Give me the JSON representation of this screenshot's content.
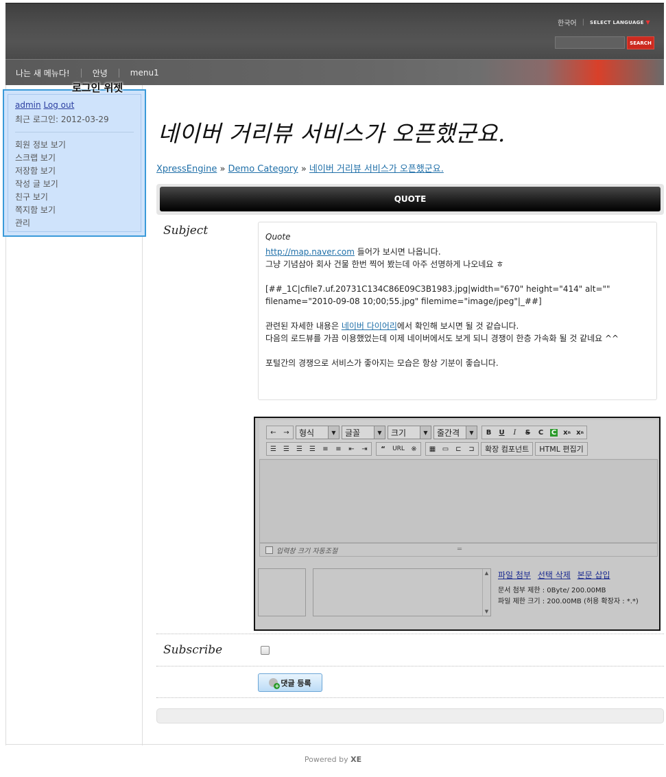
{
  "header": {
    "language": "한국어",
    "select_language": "SELECT LANGUAGE",
    "search_button": "SEARCH",
    "search_placeholder": ""
  },
  "nav": {
    "items": [
      {
        "label": "나는 새 메뉴다!"
      },
      {
        "label": "안녕"
      },
      {
        "label": "menu1"
      }
    ]
  },
  "login_widget": {
    "label": "로그인 위젯",
    "user": "admin",
    "logout": "Log out",
    "last_login": "최근 로그인: 2012-03-29",
    "menu": [
      "회원 정보 보기",
      "스크랩 보기",
      "저장함 보기",
      "작성 글 보기",
      "친구 보기",
      "쪽지함 보기",
      "관리"
    ]
  },
  "document": {
    "title": "네이버 거리뷰 서비스가 오픈했군요.",
    "breadcrumb": {
      "home": "XpressEngine",
      "sep1": " » ",
      "category": "Demo Category",
      "sep2": " » ",
      "current": "네이버 거리뷰 서비스가 오픈했군요."
    },
    "quote_header": "QUOTE"
  },
  "form": {
    "subject_label": "Subject",
    "quote": {
      "title": "Quote",
      "link1": "http://map.naver.com",
      "line1_rest": " 들어가 보시면 나옵니다.",
      "line2": "그냥 기념삼아 회사 건물 한번 찍어 봤는데 아주 선명하게 나오네요 ㅎ",
      "line3": "[##_1C|cfile7.uf.20731C134C86E09C3B1983.jpg|width=\"670\" height=\"414\" alt=\"\" filename=\"2010-09-08 10;00;55.jpg\" filemime=\"image/jpeg\"|_##]",
      "line4_pre": "관련된 자세한 내용은 ",
      "line4_link": "네이버 다이어리",
      "line4_rest": "에서 확인해 보시면 될 것 같습니다.",
      "line5": "다음의 로드뷰를 가끔 이용했었는데 이제 네이버에서도 보게 되니 경쟁이 한층 가속화 될 것 같네요 ^^",
      "line6": "포털간의 경쟁으로 서비스가 좋아지는 모습은 항상 기분이 좋습니다."
    },
    "editor": {
      "format_select": "형식",
      "font_select": "글꼴",
      "size_select": "크기",
      "line_height_select": "줄간격",
      "ext_component": "확장 컴포넌트",
      "html_editor": "HTML 편집기",
      "url_btn": "URL",
      "autoresize_label": "입력창 크기 자동조절",
      "attach_file": "파일 첨부",
      "delete_selected": "선택 삭제",
      "insert_body": "본문 삽입",
      "doc_limit": "문서 첨부 제한 : 0Byte/ 200.00MB",
      "file_limit": "파일 제한 크기 : 200.00MB (허용 확장자 : *.*)"
    },
    "subscribe_label": "Subscribe",
    "submit_label": "댓글 등록"
  },
  "footer": {
    "powered_by": "Powered by",
    "brand": "XE"
  }
}
